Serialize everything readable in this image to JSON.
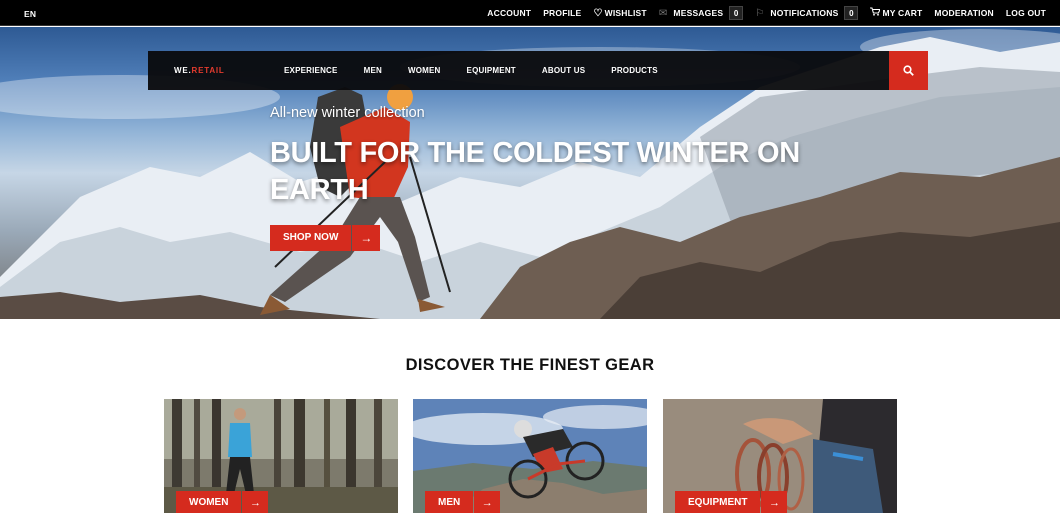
{
  "topbar": {
    "language": "EN",
    "links": {
      "account": "ACCOUNT",
      "profile": "PROFILE",
      "wishlist": "WISHLIST",
      "messages": "MESSAGES",
      "messages_count": "0",
      "notifications": "NOTIFICATIONS",
      "notifications_count": "0",
      "cart": "MY CART",
      "moderation": "MODERATION",
      "logout": "LOG OUT"
    },
    "icons": {
      "wishlist": "heart-icon",
      "messages": "envelope-icon",
      "notifications": "flag-icon",
      "cart": "cart-icon"
    }
  },
  "nav": {
    "logo_part1": "WE.",
    "logo_part2": "RETAIL",
    "items": [
      "EXPERIENCE",
      "MEN",
      "WOMEN",
      "EQUIPMENT",
      "ABOUT US",
      "PRODUCTS"
    ],
    "search_icon": "search-icon"
  },
  "hero": {
    "subtitle": "All-new winter collection",
    "headline": "BUILT FOR THE COLDEST WINTER ON EARTH",
    "cta_label": "SHOP NOW",
    "cta_icon": "arrow-right-icon"
  },
  "discover": {
    "title": "DISCOVER THE FINEST GEAR",
    "cards": [
      {
        "label": "WOMEN"
      },
      {
        "label": "MEN"
      },
      {
        "label": "EQUIPMENT"
      }
    ]
  },
  "colors": {
    "accent": "#d52b1e",
    "topbar": "#000000",
    "nav": "#0a0a0c"
  }
}
